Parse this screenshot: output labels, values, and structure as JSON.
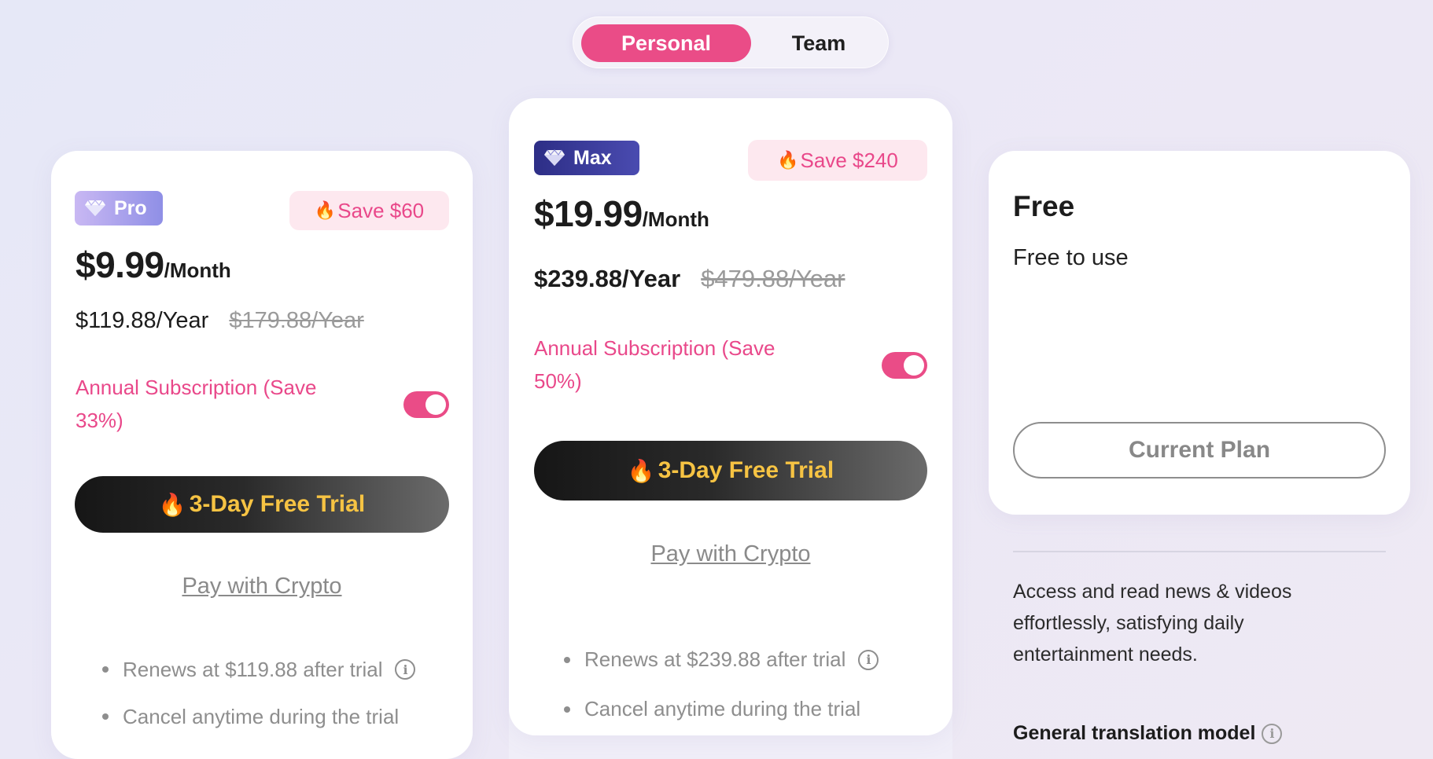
{
  "plan_toggle": {
    "personal": "Personal",
    "team": "Team"
  },
  "pro": {
    "badge": "Pro",
    "save": "Save $60",
    "price": "$9.99",
    "per": "/Month",
    "year_price": "$119.88/Year",
    "year_original": "$179.88/Year",
    "annual_text": "Annual Subscription (Save 33%)",
    "annual_enabled": true,
    "trial_button": "3-Day Free Trial",
    "crypto_link": "Pay with Crypto",
    "bullets": [
      "Renews at $119.88 after trial",
      "Cancel anytime during the trial"
    ]
  },
  "max": {
    "badge": "Max",
    "save": "Save $240",
    "price": "$19.99",
    "per": "/Month",
    "year_price": "$239.88/Year",
    "year_original": "$479.88/Year",
    "annual_text": "Annual Subscription (Save 50%)",
    "annual_enabled": true,
    "trial_button": "3-Day Free Trial",
    "crypto_link": "Pay with Crypto",
    "bullets": [
      "Renews at $239.88 after trial",
      "Cancel anytime during the trial"
    ]
  },
  "free": {
    "title": "Free",
    "subtitle": "Free to use",
    "current_button": "Current Plan",
    "description": "Access and read news & videos effortlessly, satisfying daily entertainment needs.",
    "feature": "General translation model"
  },
  "icons": {
    "gem": "diamond-icon",
    "flame": "fire-icon",
    "info": "info-icon"
  },
  "colors": {
    "accent": "#ea4c87",
    "trial_text": "#f6c343",
    "pro_badge": "#a9a3ee",
    "max_badge": "#2d2e86"
  }
}
